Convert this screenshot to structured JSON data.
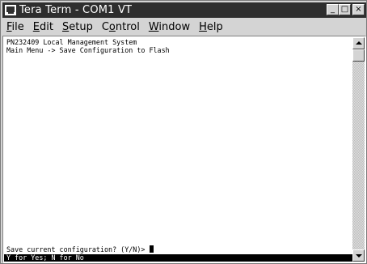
{
  "window": {
    "title": "Tera Term - COM1 VT",
    "minimize_label": "_",
    "maximize_label": "□",
    "close_label": "×"
  },
  "menu": {
    "items": [
      {
        "underline": "F",
        "rest": "ile"
      },
      {
        "underline": "E",
        "rest": "dit"
      },
      {
        "underline": "S",
        "rest": "etup"
      },
      {
        "prefix": "C",
        "underline": "o",
        "rest": "ntrol"
      },
      {
        "underline": "W",
        "rest": "indow"
      },
      {
        "underline": "H",
        "rest": "elp"
      }
    ]
  },
  "terminal": {
    "lines": [
      "PN232409 Local Management System",
      "Main Menu -> Save Configuration to Flash"
    ],
    "prompt": "Save current configuration? (Y/N)> ",
    "status": "Y for Yes; N for No"
  },
  "icons": {
    "app": "terminal-app-icon",
    "minimize": "minimize-icon",
    "maximize": "maximize-icon",
    "close": "close-icon",
    "scroll_up": "arrow-up-icon",
    "scroll_down": "arrow-down-icon"
  },
  "colors": {
    "titlebar": "#2e2e2e",
    "chrome": "#d4d4d4",
    "terminal_bg": "#ffffff",
    "terminal_fg": "#000000",
    "status_bg": "#000000",
    "status_fg": "#ffffff"
  }
}
